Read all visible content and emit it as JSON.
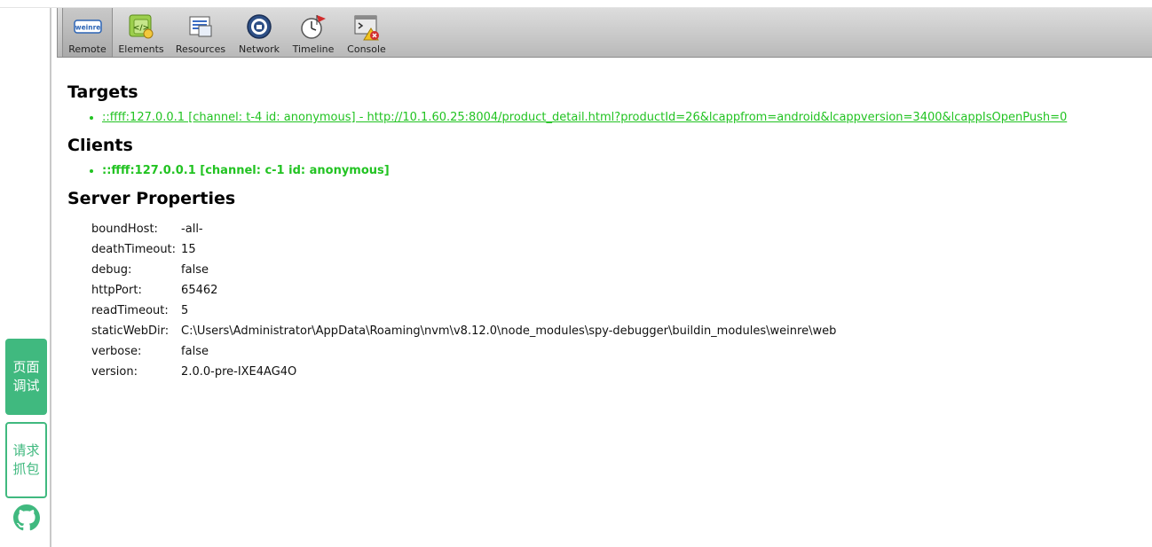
{
  "toolbar": {
    "items": [
      {
        "label": "Remote",
        "icon": "weinre-logo-icon"
      },
      {
        "label": "Elements",
        "icon": "elements-icon"
      },
      {
        "label": "Resources",
        "icon": "resources-icon"
      },
      {
        "label": "Network",
        "icon": "network-icon"
      },
      {
        "label": "Timeline",
        "icon": "timeline-icon"
      },
      {
        "label": "Console",
        "icon": "console-icon"
      }
    ],
    "logo_text": "weinre"
  },
  "sidebar": {
    "page_debug": "页面调试",
    "request_capture": "请求抓包",
    "github_icon": "github-icon"
  },
  "targets": {
    "heading": "Targets",
    "items": [
      "::ffff:127.0.0.1 [channel: t-4 id: anonymous] - http://10.1.60.25:8004/product_detail.html?productId=26&lcappfrom=android&lcappversion=3400&lcappIsOpenPush=0"
    ]
  },
  "clients": {
    "heading": "Clients",
    "items": [
      "::ffff:127.0.0.1 [channel: c-1 id: anonymous]"
    ]
  },
  "server": {
    "heading": "Server Properties",
    "props": [
      {
        "key": "boundHost:",
        "value": "-all-"
      },
      {
        "key": "deathTimeout:",
        "value": "15"
      },
      {
        "key": "debug:",
        "value": "false"
      },
      {
        "key": "httpPort:",
        "value": "65462"
      },
      {
        "key": "readTimeout:",
        "value": "5"
      },
      {
        "key": "staticWebDir:",
        "value": "C:\\Users\\Administrator\\AppData\\Roaming\\nvm\\v8.12.0\\node_modules\\spy-debugger\\buildin_modules\\weinre\\web"
      },
      {
        "key": "verbose:",
        "value": "false"
      },
      {
        "key": "version:",
        "value": "2.0.0-pre-IXE4AG4O"
      }
    ]
  },
  "colors": {
    "accent_green": "#40b97f",
    "link_green": "#22c322"
  }
}
